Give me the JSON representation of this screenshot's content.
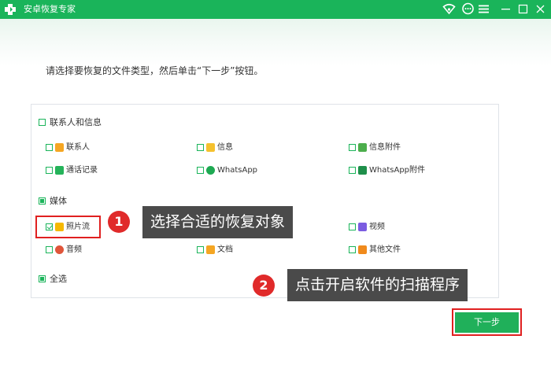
{
  "window": {
    "title": "安卓恢复专家",
    "brand_color": "#1ab45a",
    "controls": [
      "wifi-icon",
      "message-icon",
      "menu-icon",
      "minimize-icon",
      "maximize-icon",
      "close-icon"
    ]
  },
  "instruction": "请选择要恢复的文件类型，然后单击“下一步”按钮。",
  "sections": {
    "contacts": {
      "label": "联系人和信息",
      "items": [
        {
          "label": "联系人",
          "icon": "contact-icon",
          "color": "#f5a623"
        },
        {
          "label": "信息",
          "icon": "message-icon",
          "color": "#f5c12e"
        },
        {
          "label": "信息附件",
          "icon": "paperclip-icon",
          "color": "#4cae4c"
        },
        {
          "label": "通话记录",
          "icon": "phone-icon",
          "color": "#25b35a"
        },
        {
          "label": "WhatsApp",
          "icon": "whatsapp-icon",
          "color": "#1ea952"
        },
        {
          "label": "WhatsApp附件",
          "icon": "whatsapp-attachment-icon",
          "color": "#1e8f4a"
        }
      ]
    },
    "media": {
      "label": "媒体",
      "items": [
        {
          "label": "照片流",
          "icon": "star-photo-icon",
          "color": "#f5b800",
          "checked": true
        },
        {
          "label": "视频",
          "icon": "video-icon",
          "color": "#7b5ce1"
        },
        {
          "label": "音频",
          "icon": "music-icon",
          "color": "#e0553a"
        },
        {
          "label": "文档",
          "icon": "folder-icon",
          "color": "#f5a623"
        },
        {
          "label": "其他文件",
          "icon": "document-icon",
          "color": "#f08a1c"
        }
      ]
    },
    "select_all": {
      "label": "全选"
    }
  },
  "annotations": [
    {
      "number": "1",
      "text": "选择合适的恢复对象"
    },
    {
      "number": "2",
      "text": "点击开启软件的扫描程序"
    }
  ],
  "next_button": "下一步"
}
